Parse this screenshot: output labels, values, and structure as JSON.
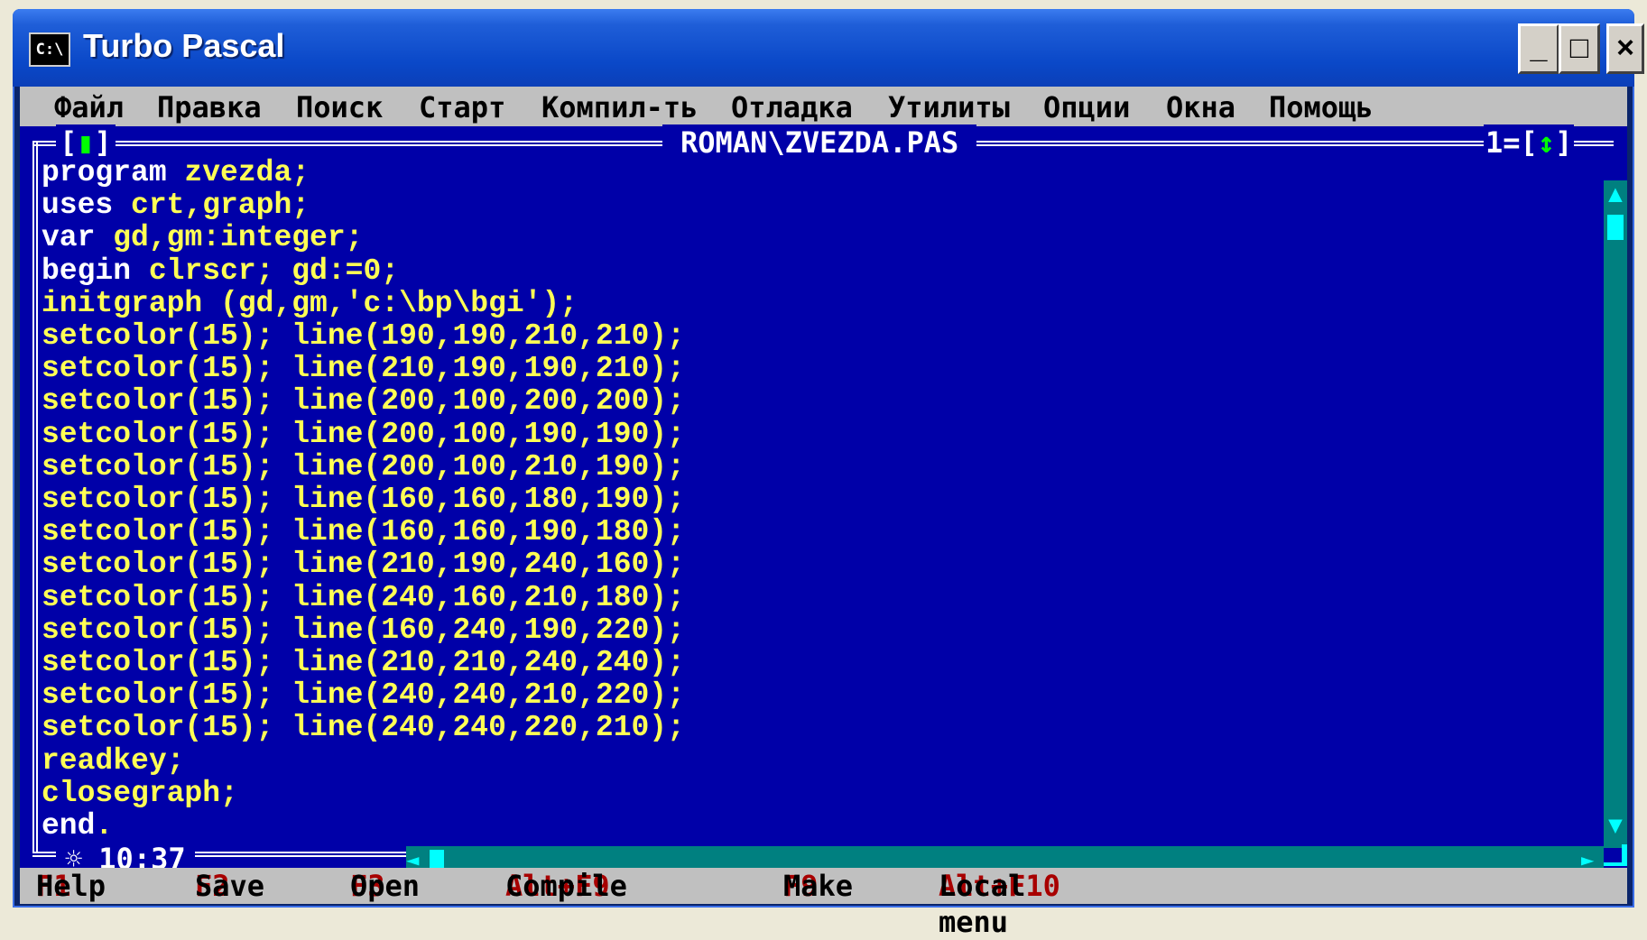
{
  "window": {
    "title": "Turbo Pascal",
    "icon_label": "C:\\",
    "minimize_label": "_",
    "maximize_label": "□",
    "close_label": "×"
  },
  "menu": [
    {
      "label": "Файл"
    },
    {
      "label": "Правка"
    },
    {
      "label": "Поиск"
    },
    {
      "label": "Старт"
    },
    {
      "label": "Компил-ть"
    },
    {
      "label": "Отладка"
    },
    {
      "label": "Утилиты"
    },
    {
      "label": "Опции"
    },
    {
      "label": "Окна"
    },
    {
      "label": "Помощь"
    }
  ],
  "editor": {
    "close_box_open": "[",
    "close_box_glyph": "▮",
    "close_box_close": "]",
    "file_title": "ROMAN\\ZVEZDA.PAS",
    "window_number": "1=[",
    "zoom_glyph": "↕",
    "zoom_close": "]",
    "status_star": "☼",
    "cursor_position": "10:37",
    "lines": [
      {
        "kw": "program",
        "rest": " zvezda;"
      },
      {
        "kw": "uses",
        "rest": " crt,graph;"
      },
      {
        "kw": "var",
        "rest": " gd,gm:integer;"
      },
      {
        "kw": "begin",
        "rest": " clrscr; gd:=0;"
      },
      {
        "kw": "",
        "rest": "initgraph (gd,gm,'c:\\bp\\bgi');"
      },
      {
        "kw": "",
        "rest": "setcolor(15); line(190,190,210,210);"
      },
      {
        "kw": "",
        "rest": "setcolor(15); line(210,190,190,210);"
      },
      {
        "kw": "",
        "rest": "setcolor(15); line(200,100,200,200);"
      },
      {
        "kw": "",
        "rest": "setcolor(15); line(200,100,190,190);"
      },
      {
        "kw": "",
        "rest": "setcolor(15); line(200,100,210,190);"
      },
      {
        "kw": "",
        "rest": "setcolor(15); line(160,160,180,190);"
      },
      {
        "kw": "",
        "rest": "setcolor(15); line(160,160,190,180);"
      },
      {
        "kw": "",
        "rest": "setcolor(15); line(210,190,240,160);"
      },
      {
        "kw": "",
        "rest": "setcolor(15); line(240,160,210,180);"
      },
      {
        "kw": "",
        "rest": "setcolor(15); line(160,240,190,220);"
      },
      {
        "kw": "",
        "rest": "setcolor(15); line(210,210,240,240);"
      },
      {
        "kw": "",
        "rest": "setcolor(15); line(240,240,210,220);"
      },
      {
        "kw": "",
        "rest": "setcolor(15); line(240,240,220,210);"
      },
      {
        "kw": "",
        "rest": "readkey;"
      },
      {
        "kw": "",
        "rest": "closegraph;"
      },
      {
        "kw": "end",
        "rest": "."
      }
    ]
  },
  "fkeys": [
    {
      "key": "F1",
      "label": "Help"
    },
    {
      "key": "F2",
      "label": "Save"
    },
    {
      "key": "F3",
      "label": "Open"
    },
    {
      "key": "Alt+F9",
      "label": "Compile"
    },
    {
      "key": "F9",
      "label": "Make"
    },
    {
      "key": "Alt+F10",
      "label": "Local menu"
    }
  ],
  "colors": {
    "editor_bg": "#0000a8",
    "code_text": "#ffff55",
    "keyword": "#ffffff",
    "menu_bg": "#c0c0c0",
    "hotkey": "#a80000",
    "scrollbar": "#008080"
  }
}
